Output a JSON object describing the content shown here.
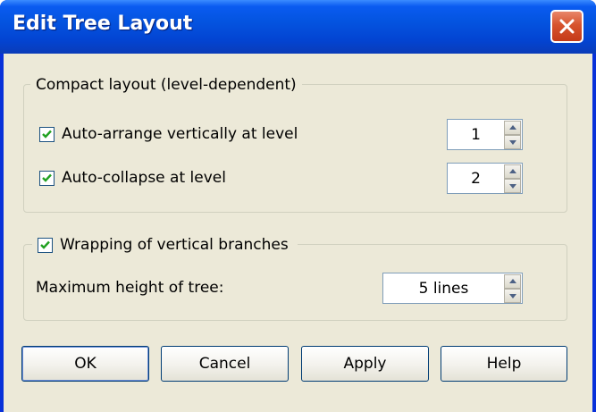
{
  "window": {
    "title": "Edit Tree Layout"
  },
  "compact_group": {
    "legend": "Compact layout (level-dependent)",
    "auto_arrange": {
      "label": "Auto-arrange vertically at level",
      "checked": true,
      "value": "1"
    },
    "auto_collapse": {
      "label": "Auto-collapse at level",
      "checked": true,
      "value": "2"
    }
  },
  "wrapping_group": {
    "legend": "Wrapping of vertical branches",
    "checked": true,
    "max_height": {
      "label": "Maximum height of tree:",
      "value": "5 lines"
    }
  },
  "buttons": {
    "ok": "OK",
    "cancel": "Cancel",
    "apply": "Apply",
    "help": "Help"
  },
  "colors": {
    "title_bar": "#0454e0",
    "dialog_bg": "#ece9d8",
    "close_button": "#d7542e"
  }
}
